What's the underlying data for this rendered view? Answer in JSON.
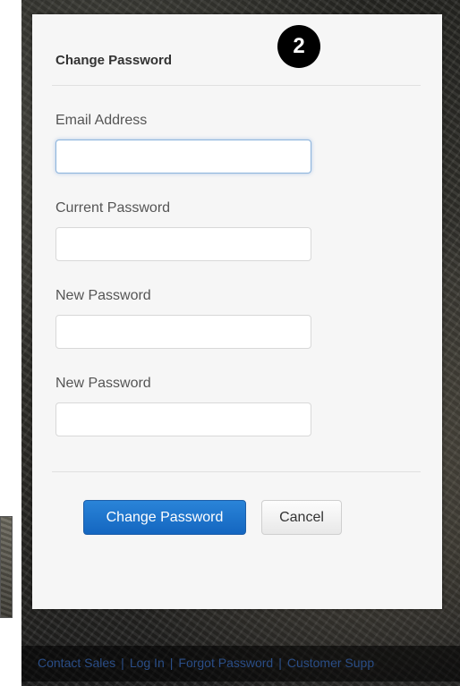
{
  "step_badge": "2",
  "dialog": {
    "title": "Change Password",
    "fields": [
      {
        "label": "Email Address",
        "value": "",
        "placeholder": ""
      },
      {
        "label": "Current Password",
        "value": "",
        "placeholder": ""
      },
      {
        "label": "New Password",
        "value": "",
        "placeholder": ""
      },
      {
        "label": "New Password",
        "value": "",
        "placeholder": ""
      }
    ],
    "primary_button": "Change Password",
    "cancel_button": "Cancel"
  },
  "footer": {
    "links": [
      "Contact Sales",
      "Log In",
      "Forgot Password",
      "Customer Supp"
    ]
  },
  "colors": {
    "primary": "#1a6fca",
    "dialog_bg": "#f6f6f6",
    "link": "#2a4d86"
  }
}
